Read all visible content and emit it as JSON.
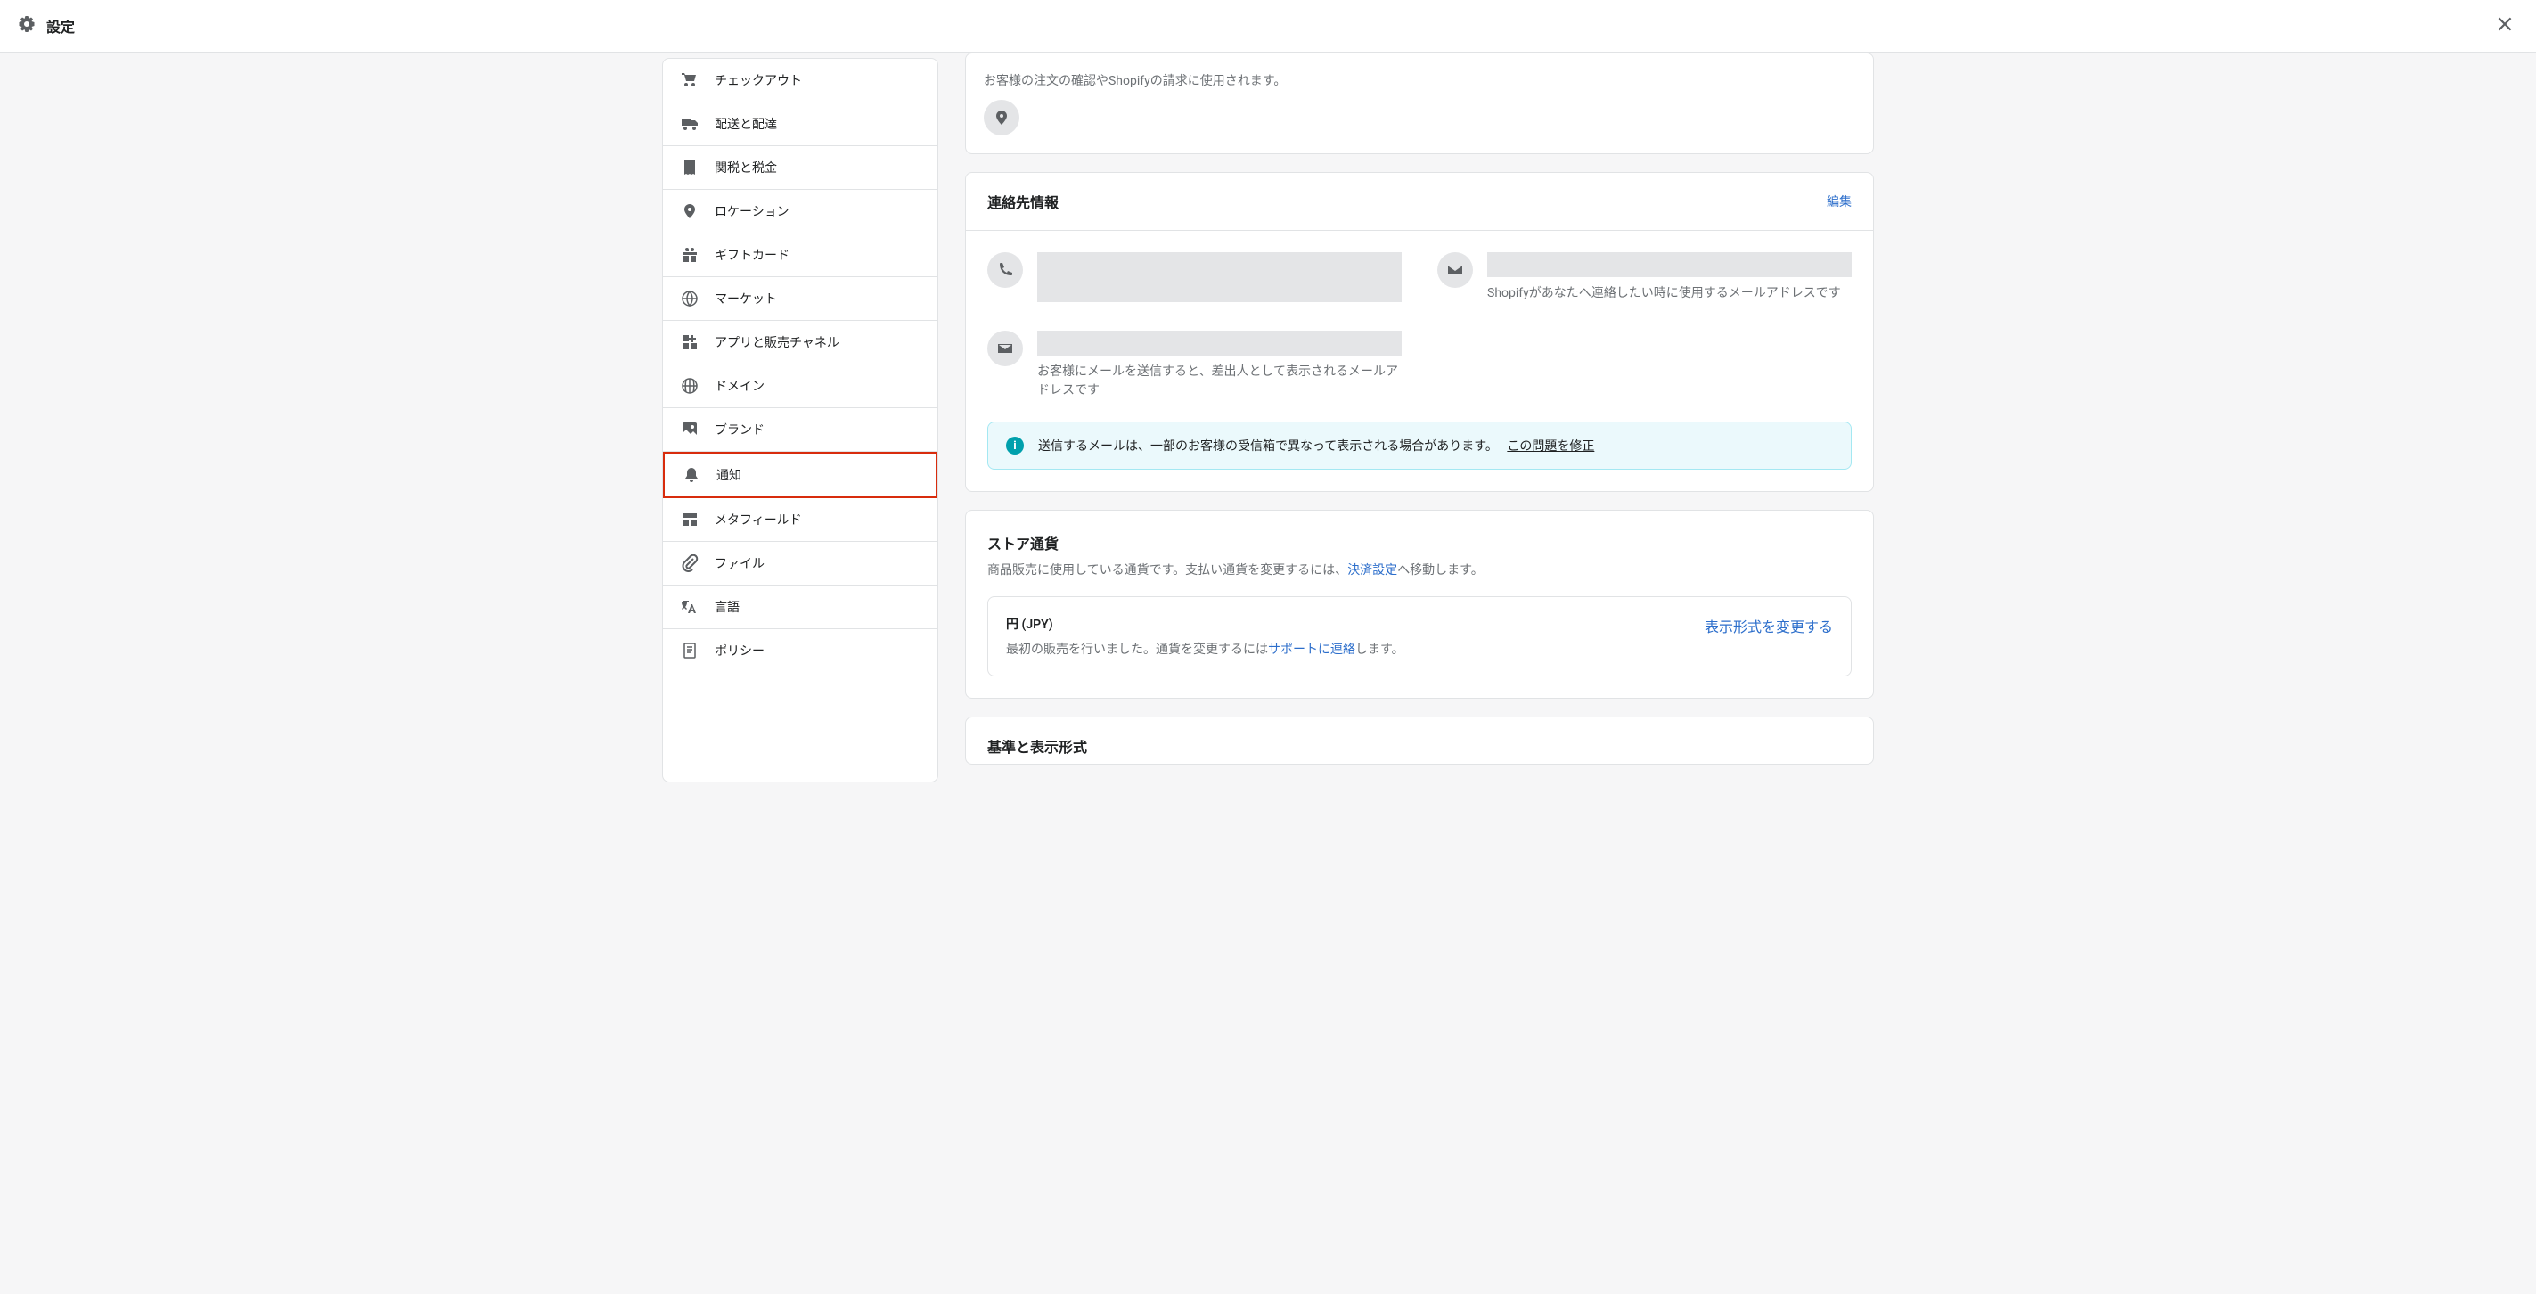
{
  "header": {
    "title": "設定"
  },
  "sidebar": {
    "items": [
      {
        "label": "チェックアウト",
        "icon": "cart"
      },
      {
        "label": "配送と配達",
        "icon": "truck"
      },
      {
        "label": "関税と税金",
        "icon": "receipt"
      },
      {
        "label": "ロケーション",
        "icon": "location"
      },
      {
        "label": "ギフトカード",
        "icon": "gift"
      },
      {
        "label": "マーケット",
        "icon": "globe"
      },
      {
        "label": "アプリと販売チャネル",
        "icon": "apps"
      },
      {
        "label": "ドメイン",
        "icon": "domain"
      },
      {
        "label": "ブランド",
        "icon": "brand"
      },
      {
        "label": "通知",
        "icon": "bell",
        "highlighted": true
      },
      {
        "label": "メタフィールド",
        "icon": "metafields"
      },
      {
        "label": "ファイル",
        "icon": "attachment"
      },
      {
        "label": "言語",
        "icon": "language"
      },
      {
        "label": "ポリシー",
        "icon": "policy"
      }
    ]
  },
  "partial_card": {
    "text": "お客様の注文の確認やShopifyの請求に使用されます。"
  },
  "contact_section": {
    "title": "連絡先情報",
    "edit_label": "編集",
    "email_desc_shopify": "Shopifyがあなたへ連絡したい時に使用するメールアドレスです",
    "email_desc_sender": "お客様にメールを送信すると、差出人として表示されるメールアドレスです",
    "banner_text": "送信するメールは、一部のお客様の受信箱で異なって表示される場合があります。",
    "banner_link": "この問題を修正"
  },
  "currency_section": {
    "title": "ストア通貨",
    "desc_pre": "商品販売に使用している通貨です。支払い通貨を変更するには、",
    "desc_link": "決済設定",
    "desc_post": "へ移動します。",
    "currency_name": "円 (JPY)",
    "currency_note_pre": "最初の販売を行いました。通貨を変更するには",
    "currency_note_link": "サポートに連絡",
    "currency_note_post": "します。",
    "format_link": "表示形式を変更する"
  },
  "standards_section": {
    "title": "基準と表示形式"
  }
}
